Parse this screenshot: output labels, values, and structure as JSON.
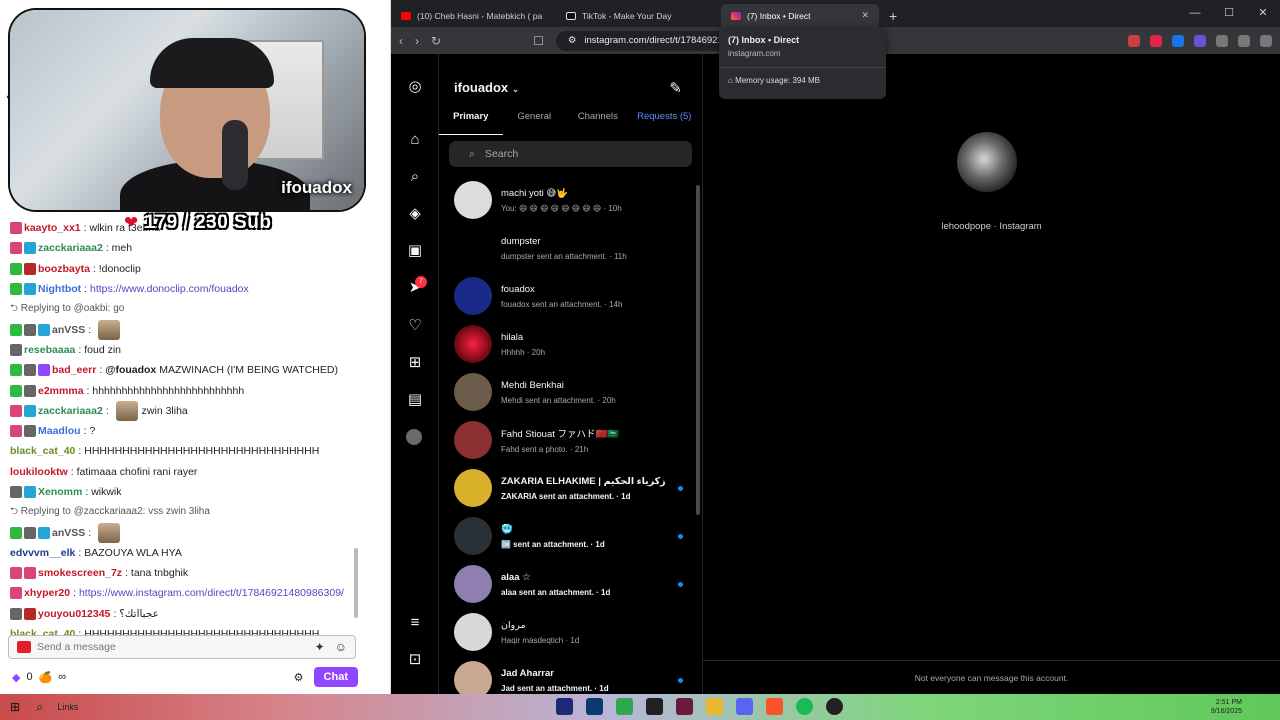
{
  "stream": {
    "streamer_tag": "ifouadox",
    "sub_goal": "179 / 230 Sub"
  },
  "chat": {
    "messages": [
      {
        "user": "kaayto_xx1",
        "text": "wlkin ra t3ebha"
      },
      {
        "user": "zacckariaaa2",
        "text": "meh"
      },
      {
        "user": "boozbayta",
        "text": "!donoclip"
      },
      {
        "user": "Nightbot",
        "link": "https://www.donoclip.com/fouadox"
      },
      {
        "reply": "Replying to @oakbi: go"
      },
      {
        "user": "anVSS",
        "text": ""
      },
      {
        "user": "resebaaaa",
        "text": "foud zin"
      },
      {
        "user": "bad_eerr",
        "mention": "@fouadox",
        "text": "MAZWINACH (I'M BEING WATCHED)"
      },
      {
        "user": "e2mmma",
        "text": "hhhhhhhhhhhhhhhhhhhhhhhhhh"
      },
      {
        "user": "zacckariaaa2",
        "text": "zwin 3liha"
      },
      {
        "user": "Maadlou",
        "text": "?"
      },
      {
        "user": "black_cat_40",
        "text": "HHHHHHHHHHHHHHHHHHHHHHHHHHHHHHH"
      },
      {
        "user": "loukilooktw",
        "text": "fatimaaa chofini rani rayer"
      },
      {
        "user": "Xenomm",
        "text": "wikwik"
      },
      {
        "reply": "Replying to @zacckariaaa2: vss zwin 3liha"
      },
      {
        "user": "anVSS",
        "text": ""
      },
      {
        "user": "edvvvm__elk",
        "text": "BAZOUYA WLA HYA"
      },
      {
        "user": "smokescreen_7z",
        "text": "tana tnbghik"
      },
      {
        "user": "xhyper20",
        "link": "https://www.instagram.com/direct/t/17846921480986309/"
      },
      {
        "user": "youyou012345",
        "text": "عجبااتك؟"
      },
      {
        "user": "black_cat_40",
        "text": "HHHHHHHHHHHHHHHHHHHHHHHHHHHHHHH"
      }
    ],
    "input_placeholder": "Send a message",
    "points": "0",
    "chat_button": "Chat"
  },
  "browser": {
    "tabs": [
      {
        "title": "(10) Cheb Hasni - Matebkich ( pa"
      },
      {
        "title": "TikTok - Make Your Day"
      },
      {
        "title": "(7) Inbox • Direct"
      }
    ],
    "url": "instagram.com/direct/t/17846921",
    "hover": {
      "title": "(7) Inbox • Direct",
      "domain": "instagram.com",
      "memory": "Memory usage: 394 MB"
    }
  },
  "instagram": {
    "username": "ifouadox",
    "tabs": [
      "Primary",
      "General",
      "Channels",
      "Requests (5)"
    ],
    "search_placeholder": "Search",
    "notification_count": "7",
    "conversations": [
      {
        "name": "machi yoti 😅🤟",
        "sub": "You: 😄 😄 😄 😄 😄 😄 😄 😄 · 10h",
        "unread": false,
        "color": "#dcdcdc"
      },
      {
        "name": "dumpster",
        "sub": "dumpster sent an attachment. · 11h",
        "unread": false,
        "color": "#000000"
      },
      {
        "name": "fouadox",
        "sub": "fouadox sent an attachment. · 14h",
        "unread": false,
        "color": "#1a2a88"
      },
      {
        "name": "hilala",
        "sub": "Hhhhh · 20h",
        "unread": false,
        "color": "#7a0c16"
      },
      {
        "name": "Mehdi Benkhai",
        "sub": "Mehdi sent an attachment. · 20h",
        "unread": false,
        "color": "#6b5b4b"
      },
      {
        "name": "Fahd Stiouat ファハド🇲🇦🇸🇦",
        "sub": "Fahd sent a photo. · 21h",
        "unread": false,
        "color": "#8a3030"
      },
      {
        "name": "ZAKARIA ELHAKIME | زكرياء الحكيم",
        "sub": "ZAKARIA sent an attachment. · 1d",
        "unread": true,
        "color": "#d8b02a"
      },
      {
        "name": "🥶",
        "sub": "🆗 sent an attachment. · 1d",
        "unread": true,
        "color": "#2a3038"
      },
      {
        "name": "alaa ☆",
        "sub": "alaa sent an attachment. · 1d",
        "unread": true,
        "color": "#8e7fb0"
      },
      {
        "name": "مروان",
        "sub": "Haqir masdeqtich · 1d",
        "unread": false,
        "color": "#d8d8d8"
      },
      {
        "name": "Jad Aharrar",
        "sub": "Jad sent an attachment. · 1d",
        "unread": true,
        "color": "#c8a890"
      }
    ],
    "profile": {
      "emoji": "😑",
      "subtitle": "lehoodpope · Instagram"
    },
    "footer_note": "Not everyone can message this account."
  },
  "taskbar": {
    "search_text": "Links",
    "time": "2:51 PM",
    "date": "9/16/2025"
  }
}
